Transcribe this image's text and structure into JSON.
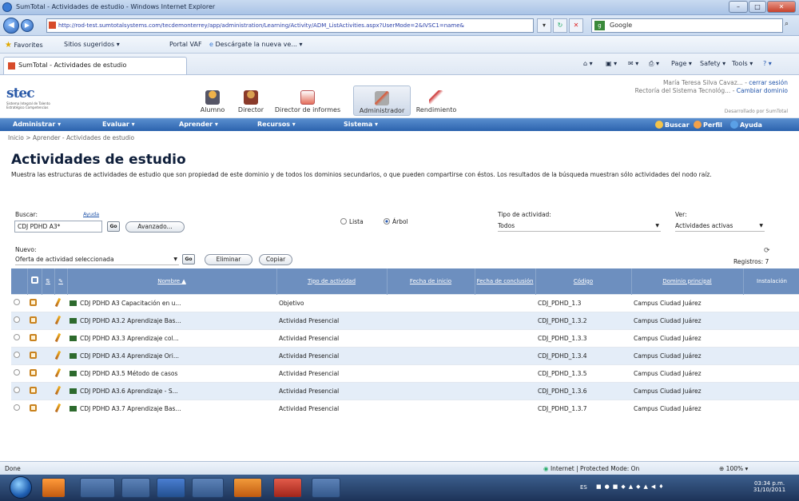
{
  "window": {
    "title": "SumTotal - Actividades de estudio - Windows Internet Explorer",
    "controls": [
      "–",
      "□",
      "✕"
    ]
  },
  "browser": {
    "url": "http://rod-test.sumtotalsystems.com/tecdemonterrey/app/administration/Learning/Activity/ADM_ListActivities.aspx?UserMode=2&IVSC1=name&",
    "search_engine": "Google",
    "favorites_label": "Favorites",
    "suggested_sites": "Sitios sugeridos ▾",
    "portal": "Portal VAF",
    "download": "Descárgate la nueva ve... ▾",
    "tab_title": "SumTotal - Actividades de estudio",
    "commands": [
      "Page ▾",
      "Safety ▾",
      "Tools ▾"
    ]
  },
  "header": {
    "logo_text": "stec",
    "logo_sub": "Sistema Integral de Talento Estratégico Competencias",
    "roles": [
      "Alumno",
      "Director",
      "Director de informes",
      "Administrador",
      "Rendimiento"
    ],
    "user_name": "María Teresa Silva Cavaz... - ",
    "logout": "cerrar sesión",
    "org": "Rectoría del Sistema Tecnológ... - ",
    "change_domain": "Cambiar dominio",
    "developed_by": "Desarrollado por SumTotal"
  },
  "menu": {
    "items": [
      "Administrar ▾",
      "Evaluar ▾",
      "Aprender ▾",
      "Recursos ▾",
      "Sistema ▾"
    ],
    "right": [
      "Buscar",
      "Perfil",
      "Ayuda"
    ]
  },
  "breadcrumb": "Inicio > Aprender - Actividades de estudio",
  "page": {
    "title": "Actividades de estudio",
    "description": "Muestra las estructuras de actividades de estudio que son propiedad de este dominio y de todos los dominios secundarios, o que pueden compartirse con éstos. Los resultados de la búsqueda muestran sólo actividades del nodo raíz."
  },
  "search": {
    "label": "Buscar:",
    "help": "Ayuda",
    "value": "CDJ PDHD A3*",
    "go": "Go",
    "advanced": "Avanzado...",
    "view_list": "Lista",
    "view_tree": "Árbol",
    "type_label": "Tipo de actividad:",
    "type_value": "Todos",
    "ver_label": "Ver:",
    "ver_value": "Actividades activas"
  },
  "actions": {
    "new_label": "Nuevo:",
    "new_value": "Oferta de actividad seleccionada",
    "go": "Go",
    "delete": "Eliminar",
    "copy": "Copiar",
    "records": "Registros: 7"
  },
  "table": {
    "columns": [
      "Nombre ▲",
      "Tipo de actividad",
      "Fecha de inicio",
      "Fecha de conclusión",
      "Código",
      "Dominio principal",
      "Instalación"
    ],
    "rows": [
      {
        "name": "CDJ PDHD A3 Capacitación en u...",
        "type": "Objetivo",
        "start": "",
        "end": "",
        "code": "CDJ_PDHD_1.3",
        "domain": "Campus Ciudad Juárez",
        "inst": ""
      },
      {
        "name": "CDJ PDHD A3.2 Aprendizaje Bas...",
        "type": "Actividad Presencial",
        "start": "",
        "end": "",
        "code": "CDJ_PDHD_1.3.2",
        "domain": "Campus Ciudad Juárez",
        "inst": ""
      },
      {
        "name": "CDJ PDHD A3.3 Aprendizaje col...",
        "type": "Actividad Presencial",
        "start": "",
        "end": "",
        "code": "CDJ_PDHD_1.3.3",
        "domain": "Campus Ciudad Juárez",
        "inst": ""
      },
      {
        "name": "CDJ PDHD A3.4 Aprendizaje Ori...",
        "type": "Actividad Presencial",
        "start": "",
        "end": "",
        "code": "CDJ_PDHD_1.3.4",
        "domain": "Campus Ciudad Juárez",
        "inst": ""
      },
      {
        "name": "CDJ PDHD A3.5 Método de casos",
        "type": "Actividad Presencial",
        "start": "",
        "end": "",
        "code": "CDJ_PDHD_1.3.5",
        "domain": "Campus Ciudad Juárez",
        "inst": ""
      },
      {
        "name": "CDJ PDHD A3.6 Aprendizaje - S...",
        "type": "Actividad Presencial",
        "start": "",
        "end": "",
        "code": "CDJ_PDHD_1.3.6",
        "domain": "Campus Ciudad Juárez",
        "inst": ""
      },
      {
        "name": "CDJ PDHD A3.7 Aprendizaje Bas...",
        "type": "Actividad Presencial",
        "start": "",
        "end": "",
        "code": "CDJ_PDHD_1.3.7",
        "domain": "Campus Ciudad Juárez",
        "inst": ""
      }
    ]
  },
  "status": {
    "left": "Done",
    "zone": "Internet | Protected Mode: On",
    "zoom": "100%"
  },
  "taskbar": {
    "lang": "ES",
    "time": "03:34 p.m.",
    "date": "31/10/2011"
  }
}
